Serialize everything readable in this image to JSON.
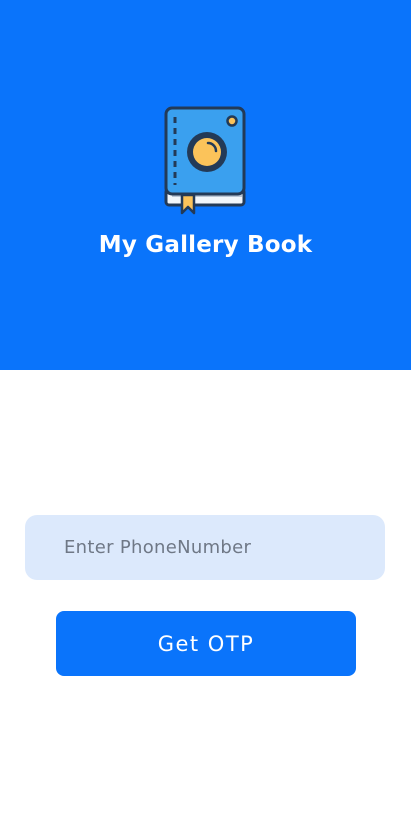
{
  "app": {
    "title": "My Gallery Book",
    "logo_icon": "photo-book-icon"
  },
  "login": {
    "phone_placeholder": "Enter PhoneNumber",
    "phone_value": "",
    "otp_button_label": "Get OTP"
  },
  "colors": {
    "primary": "#0a74fb",
    "input_background": "#dce9fc",
    "placeholder_text": "#6f7886",
    "background": "#ffffff"
  }
}
